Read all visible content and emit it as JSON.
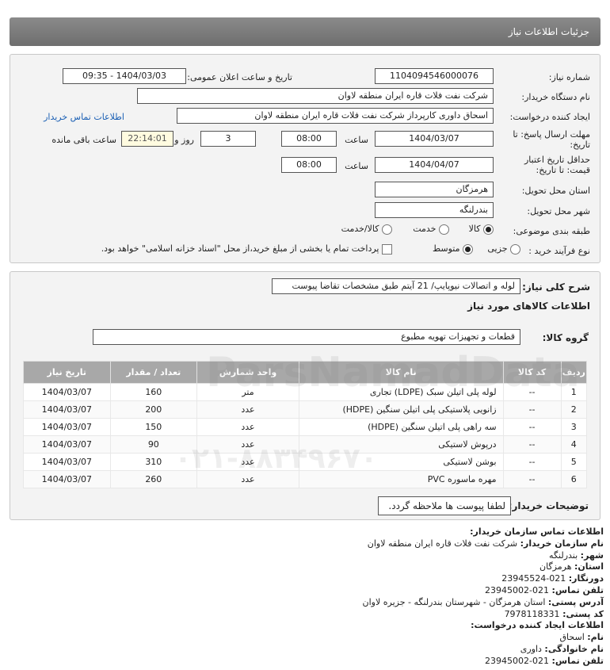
{
  "header": {
    "title": "جزئیات اطلاعات نیاز"
  },
  "form": {
    "need_number_label": "شماره نیاز:",
    "need_number": "1104094546000076",
    "announce_label": "تاریخ و ساعت اعلان عمومی:",
    "announce_value": "1404/03/03 - 09:35",
    "buyer_org_label": "نام دستگاه خریدار:",
    "buyer_org": "شرکت نفت فلات قاره ایران منطقه لاوان",
    "creator_label": "ایجاد کننده درخواست:",
    "creator": "اسحاق داوری کارپرداز شرکت نفت فلات قاره ایران منطقه لاوان",
    "contact_link": "اطلاعات تماس خریدار",
    "deadline_label": "مهلت ارسال پاسخ: تا تاریخ:",
    "deadline_date": "1404/03/07",
    "time_label": "ساعت",
    "deadline_time": "08:00",
    "days": "3",
    "days_label": "روز و",
    "remaining": "22:14:01",
    "remaining_label": "ساعت باقی مانده",
    "validity_label": "حداقل تاریخ اعتبار قیمت: تا تاریخ:",
    "validity_date": "1404/04/07",
    "validity_time": "08:00",
    "province_label": "استان محل تحویل:",
    "province": "هرمزگان",
    "city_label": "شهر محل تحویل:",
    "city": "بندرلنگه",
    "category_label": "طبقه بندی موضوعی:",
    "cat_goods": "کالا",
    "cat_service": "خدمت",
    "cat_both": "کالا/خدمت",
    "process_label": "نوع فرآیند خرید :",
    "proc_partial": "جزیی",
    "proc_medium": "متوسط",
    "payment_note": "پرداخت تمام یا بخشی از مبلغ خرید،از محل \"اسناد خزانه اسلامی\" خواهد بود."
  },
  "details": {
    "desc_label": "شرح کلی نیاز:",
    "desc": "لوله و اتصالات نیوپایپ/ 21 آیتم طبق مشخصات تقاضا پیوست",
    "goods_info_title": "اطلاعات کالاهای مورد نیاز",
    "group_label": "گروه کالا:",
    "group": "قطعات و تجهیزات تهویه مطبوع",
    "table_headers": [
      "ردیف",
      "کد کالا",
      "نام کالا",
      "واحد شمارش",
      "تعداد / مقدار",
      "تاریخ نیاز"
    ],
    "rows": [
      [
        "1",
        "--",
        "لوله پلی اتیلن سبک (LDPE) تجاری",
        "متر",
        "160",
        "1404/03/07"
      ],
      [
        "2",
        "--",
        "زانویی پلاستیکی پلی اتیلن سنگین (HDPE)",
        "عدد",
        "200",
        "1404/03/07"
      ],
      [
        "3",
        "--",
        "سه راهی پلی اتیلن سنگین (HDPE)",
        "عدد",
        "150",
        "1404/03/07"
      ],
      [
        "4",
        "--",
        "درپوش لاستیکی",
        "عدد",
        "90",
        "1404/03/07"
      ],
      [
        "5",
        "--",
        "بوشن لاستیکی",
        "عدد",
        "310",
        "1404/03/07"
      ],
      [
        "6",
        "--",
        "مهره ماسوره PVC",
        "عدد",
        "260",
        "1404/03/07"
      ]
    ],
    "buyer_notes_label": "توضیحات خریدار:",
    "buyer_notes": "لطفا پیوست ها ملاحظه گردد."
  },
  "contact": {
    "title": "اطلاعات تماس سازمان خریدار:",
    "org_k": "نام سازمان خریدار:",
    "org_v": "شرکت نفت فلات قاره ایران منطقه لاوان",
    "city_k": "شهر:",
    "city_v": "بندرلنگه",
    "prov_k": "استان:",
    "prov_v": "هرمزگان",
    "fax_k": "دورنگار:",
    "fax_v": "021-23945524",
    "tel_k": "تلفن تماس:",
    "tel_v": "021-23945002",
    "addr_k": "آدرس پستی:",
    "addr_v": "استان هرمزگان - شهرستان بندرلنگه - جزیره لاوان",
    "post_k": "کد پستی:",
    "post_v": "7978118331",
    "creator_title": "اطلاعات ایجاد کننده درخواست:",
    "name_k": "نام:",
    "name_v": "اسحاق",
    "family_k": "نام خانوادگی:",
    "family_v": "داوری",
    "ctel_k": "تلفن تماس:",
    "ctel_v": "021-23945002"
  },
  "watermark": {
    "text1": "Pars",
    "text2": "NamadData",
    "phone": "۰۲۱-۸۸۳۴۹۶۷۰"
  }
}
